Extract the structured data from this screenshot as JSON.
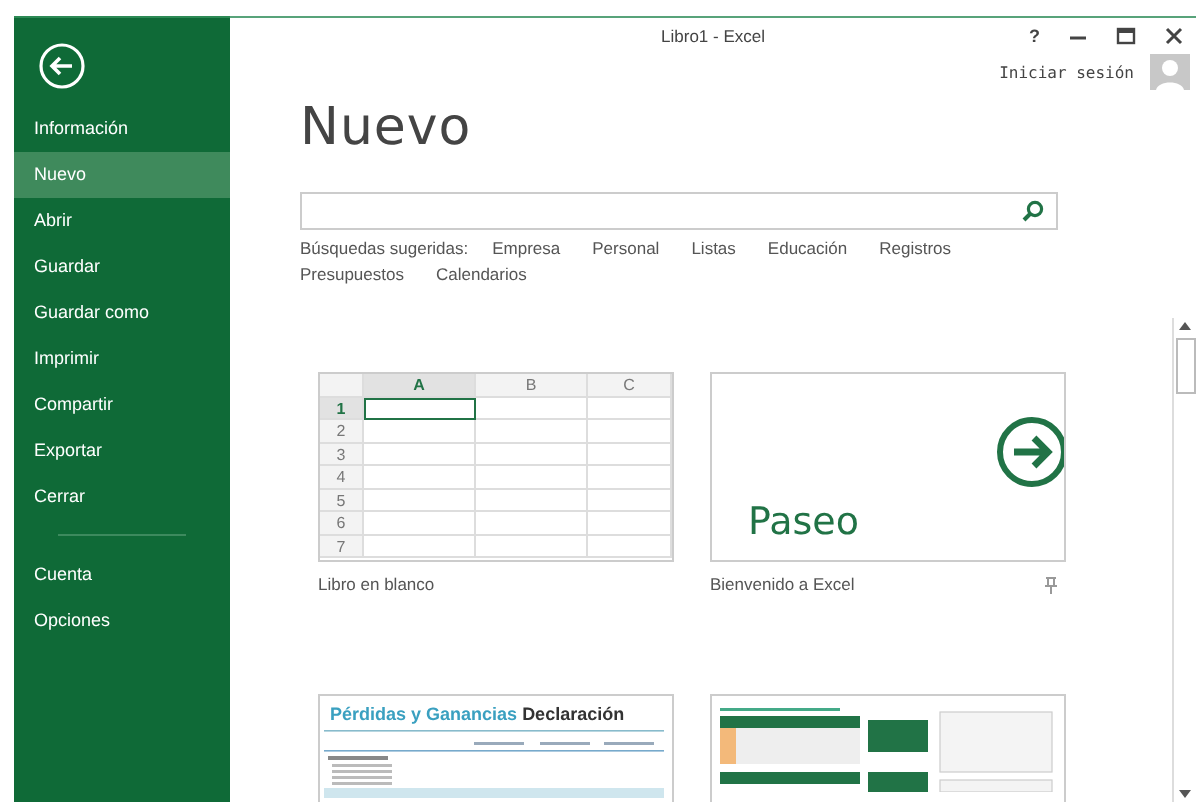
{
  "window": {
    "title": "Libro1 - Excel",
    "help": "?",
    "sign_in": "Iniciar sesión"
  },
  "sidebar": {
    "items": [
      {
        "label": "Información",
        "selected": false
      },
      {
        "label": "Nuevo",
        "selected": true
      },
      {
        "label": "Abrir",
        "selected": false
      },
      {
        "label": "Guardar",
        "selected": false
      },
      {
        "label": "Guardar como",
        "selected": false
      },
      {
        "label": "Imprimir",
        "selected": false
      },
      {
        "label": "Compartir",
        "selected": false
      },
      {
        "label": "Exportar",
        "selected": false
      },
      {
        "label": "Cerrar",
        "selected": false
      }
    ],
    "footer_items": [
      {
        "label": "Cuenta",
        "selected": false
      },
      {
        "label": "Opciones",
        "selected": false
      }
    ]
  },
  "page": {
    "title": "Nuevo",
    "suggestions_label": "Búsquedas sugeridas:",
    "suggestions": [
      "Empresa",
      "Personal",
      "Listas",
      "Educación",
      "Registros",
      "Presupuestos",
      "Calendarios"
    ]
  },
  "templates": [
    {
      "kind": "blank",
      "label": "Libro en blanco",
      "columns": [
        "A",
        "B",
        "C"
      ],
      "rows": [
        "1",
        "2",
        "3",
        "4",
        "5",
        "6",
        "7"
      ]
    },
    {
      "kind": "tour",
      "label": "Bienvenido a Excel",
      "heading": "Paseo"
    },
    {
      "kind": "report",
      "title": "Pérdidas y Ganancias",
      "title_suffix": "Declaración"
    },
    {
      "kind": "sheet"
    }
  ]
}
